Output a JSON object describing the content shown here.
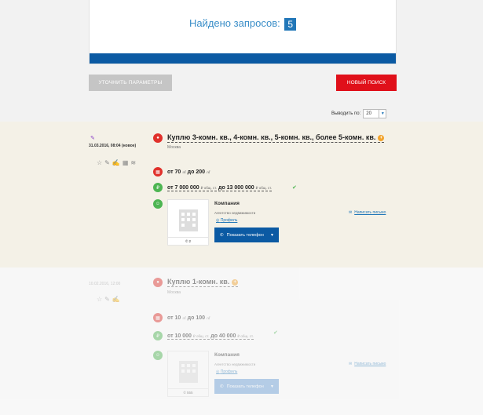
{
  "search": {
    "found_label": "Найдено запросов:",
    "found_count": "5"
  },
  "buttons": {
    "refine": "УТОЧНИТЬ ПАРАМЕТРЫ",
    "new_search": "НОВЫЙ ПОИСК"
  },
  "paging": {
    "label": "Выводить по:",
    "value": "20"
  },
  "listings": [
    {
      "date": "31.03.2016, 08:04 (новое)",
      "title": "Куплю 3-комн. кв., 4-комн. кв., 5-комн. кв., более 5-комн. кв.",
      "city": "Москва",
      "area_from": "от 70",
      "area_to": "до 200",
      "area_unit": "㎡",
      "price_from": "от 7 000 000",
      "price_to": "до 13 000 000",
      "price_unit": "₽ общ. ст.",
      "company": "Компания",
      "agency": "Агентство недвижимости",
      "profile": "Профиль",
      "thumb_caption": "© 2",
      "phone_btn": "Показать телефон",
      "write": "Написать письмо"
    },
    {
      "date": "10.02.2016, 12:00",
      "title": "Куплю 1-комн. кв.",
      "city": "Москва",
      "area_from": "от 10",
      "area_to": "до 100",
      "area_unit": "㎡",
      "price_from": "от 10 000",
      "price_to": "до 40 000",
      "price_unit": "₽ общ. ст.",
      "company": "Компания",
      "agency": "Агентство недвижимости",
      "profile": "Профиль",
      "thumb_caption": "© 555",
      "phone_btn": "Показать телефон",
      "write": "Написать письмо"
    }
  ]
}
